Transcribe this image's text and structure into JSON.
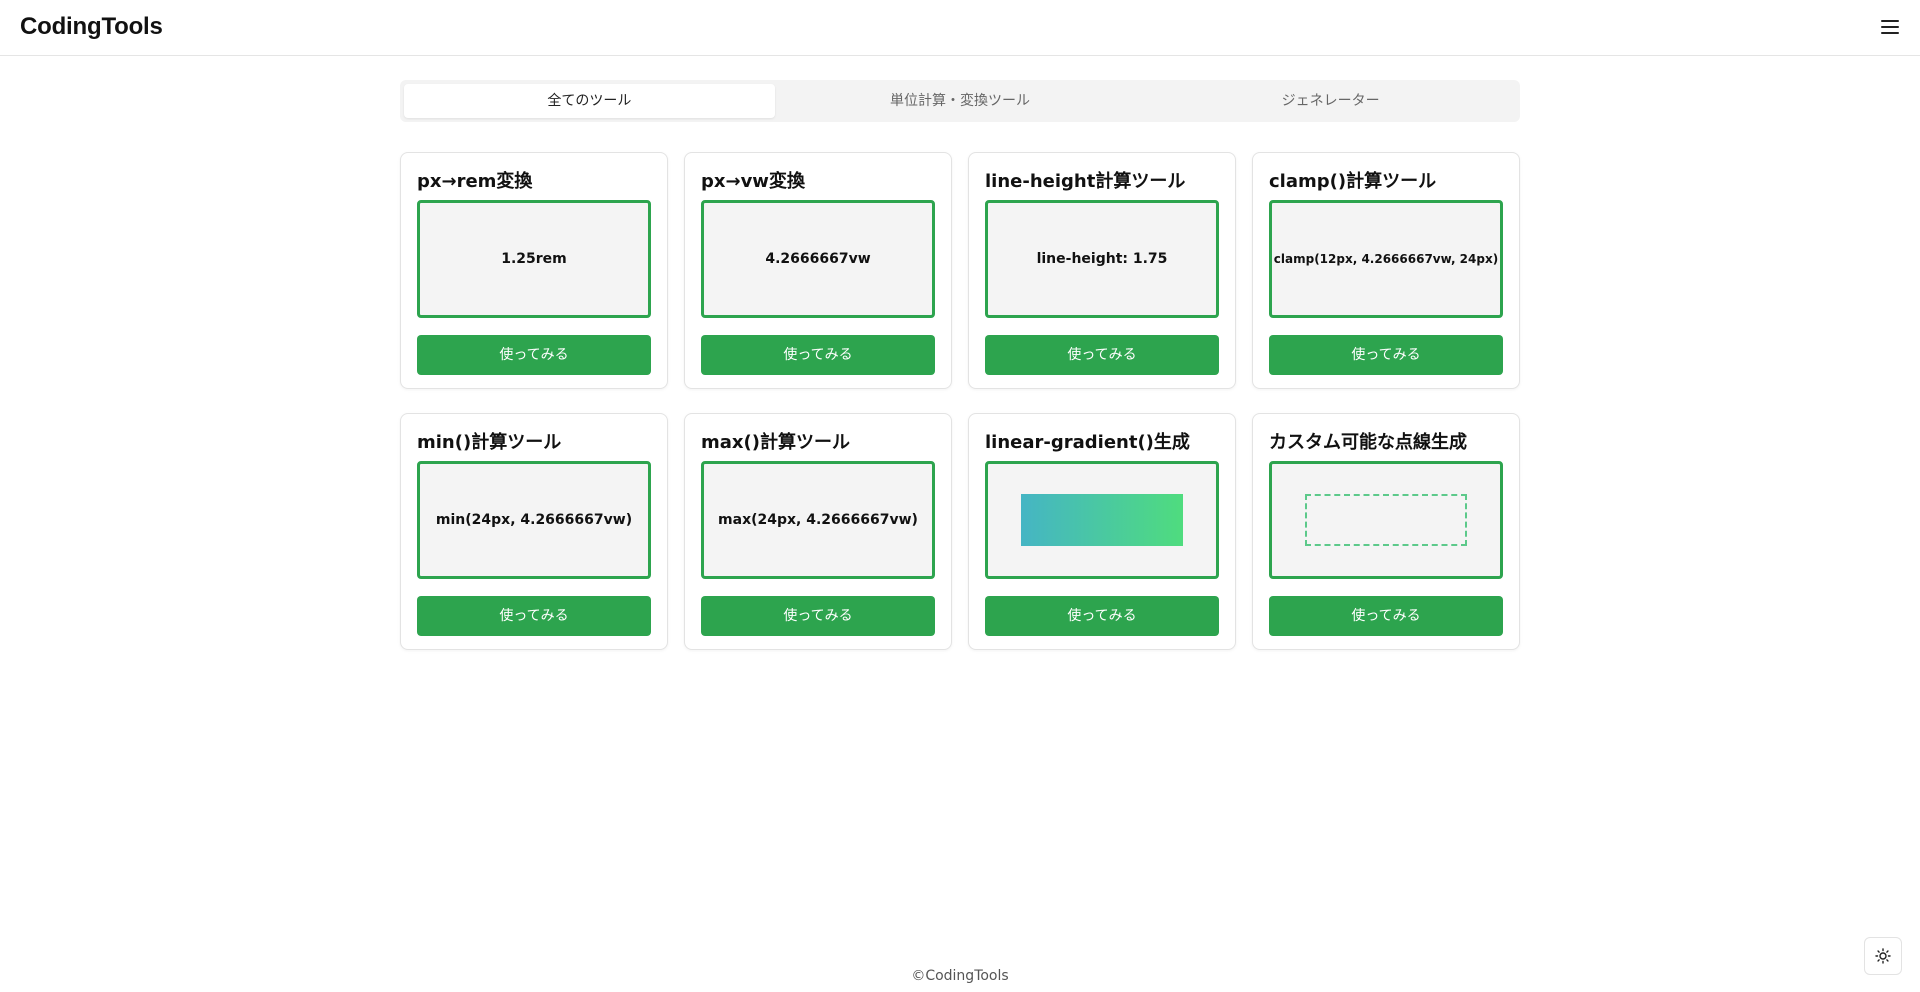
{
  "header": {
    "brand": "CodingTools",
    "menu_icon": "hamburger-menu-icon"
  },
  "tabs": [
    {
      "label": "全てのツール",
      "active": true
    },
    {
      "label": "単位計算・変換ツール",
      "active": false
    },
    {
      "label": "ジェネレーター",
      "active": false
    }
  ],
  "cards": [
    {
      "title": "px→rem変換",
      "preview": "1.25rem",
      "button": "使ってみる"
    },
    {
      "title": "px→vw変換",
      "preview": "4.2666667vw",
      "button": "使ってみる"
    },
    {
      "title": "line-height計算ツール",
      "preview": "line-height: 1.75",
      "button": "使ってみる"
    },
    {
      "title": "clamp()計算ツール",
      "preview": "clamp(12px, 4.2666667vw, 24px)",
      "button": "使ってみる"
    },
    {
      "title": "min()計算ツール",
      "preview": "min(24px, 4.2666667vw)",
      "button": "使ってみる"
    },
    {
      "title": "max()計算ツール",
      "preview": "max(24px, 4.2666667vw)",
      "button": "使ってみる"
    },
    {
      "title": "linear-gradient()生成",
      "preview_icon": "gradient-sample",
      "gradient_colors": [
        "#45b5c4",
        "#4fdc7e"
      ],
      "button": "使ってみる"
    },
    {
      "title": "カスタム可能な点線生成",
      "preview_icon": "dashed-border-sample",
      "dash_color": "#5cc98a",
      "button": "使ってみる"
    }
  ],
  "footer": {
    "copyright": "©CodingTools"
  },
  "theme_toggle": {
    "icon": "sun-icon"
  },
  "colors": {
    "accent": "#2da44e",
    "preview_bg": "#f4f4f4",
    "tab_bg": "#f3f3f3"
  }
}
